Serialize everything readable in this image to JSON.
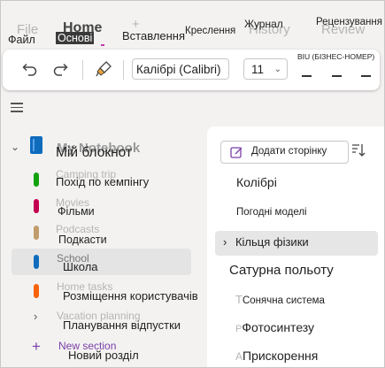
{
  "ribbon": {
    "ghost_tabs": [
      "File",
      "Home",
      "History",
      "Review"
    ],
    "tabs": {
      "file": "Файл",
      "home": "Основі",
      "insert": "Вставлення",
      "draw": "Креслення",
      "history": "Журнал",
      "review": "Рецензування"
    }
  },
  "toolbar": {
    "font_name": "Калібрі (Calibri)",
    "font_size": "11",
    "format_label": "BIU (БІЗНЕС-НОМЕР)"
  },
  "sidebar": {
    "notebook_ghost": "My Notebook",
    "notebook_title": "Мій блокнот",
    "sections": [
      {
        "ghost": "Camping trip",
        "label": "Похід по кемпінгу",
        "color": "#13a10e"
      },
      {
        "ghost": "Movies",
        "label": "Фільми",
        "color": "#c30052"
      },
      {
        "ghost": "Podcasts",
        "label": "Подкасти",
        "color": "#c19c6b"
      },
      {
        "ghost": "School",
        "label": "Школа",
        "color": "#0f6cbd"
      },
      {
        "ghost": "Home tasks",
        "label": "Розміщення користувачів",
        "color": "#f7630c"
      },
      {
        "ghost": "Vacation planning",
        "label": "Планування відпустки",
        "color": ""
      }
    ],
    "new_section_ghost": "New section",
    "new_section_label": "Новий розділ"
  },
  "pages": {
    "add_page": "Додати сторінку",
    "items": [
      {
        "ghost": "",
        "label": "Колібрі"
      },
      {
        "ghost": "",
        "label": "Погодні моделі"
      },
      {
        "ghost": "",
        "label": "Кільця фізики"
      },
      {
        "ghost": "",
        "label": "Сатурна польоту"
      },
      {
        "ghost": "T",
        "label": "Сонячна система"
      },
      {
        "ghost": "P",
        "label": "Фотосинтезу"
      },
      {
        "ghost": "A",
        "label": "Прискорення"
      }
    ]
  }
}
